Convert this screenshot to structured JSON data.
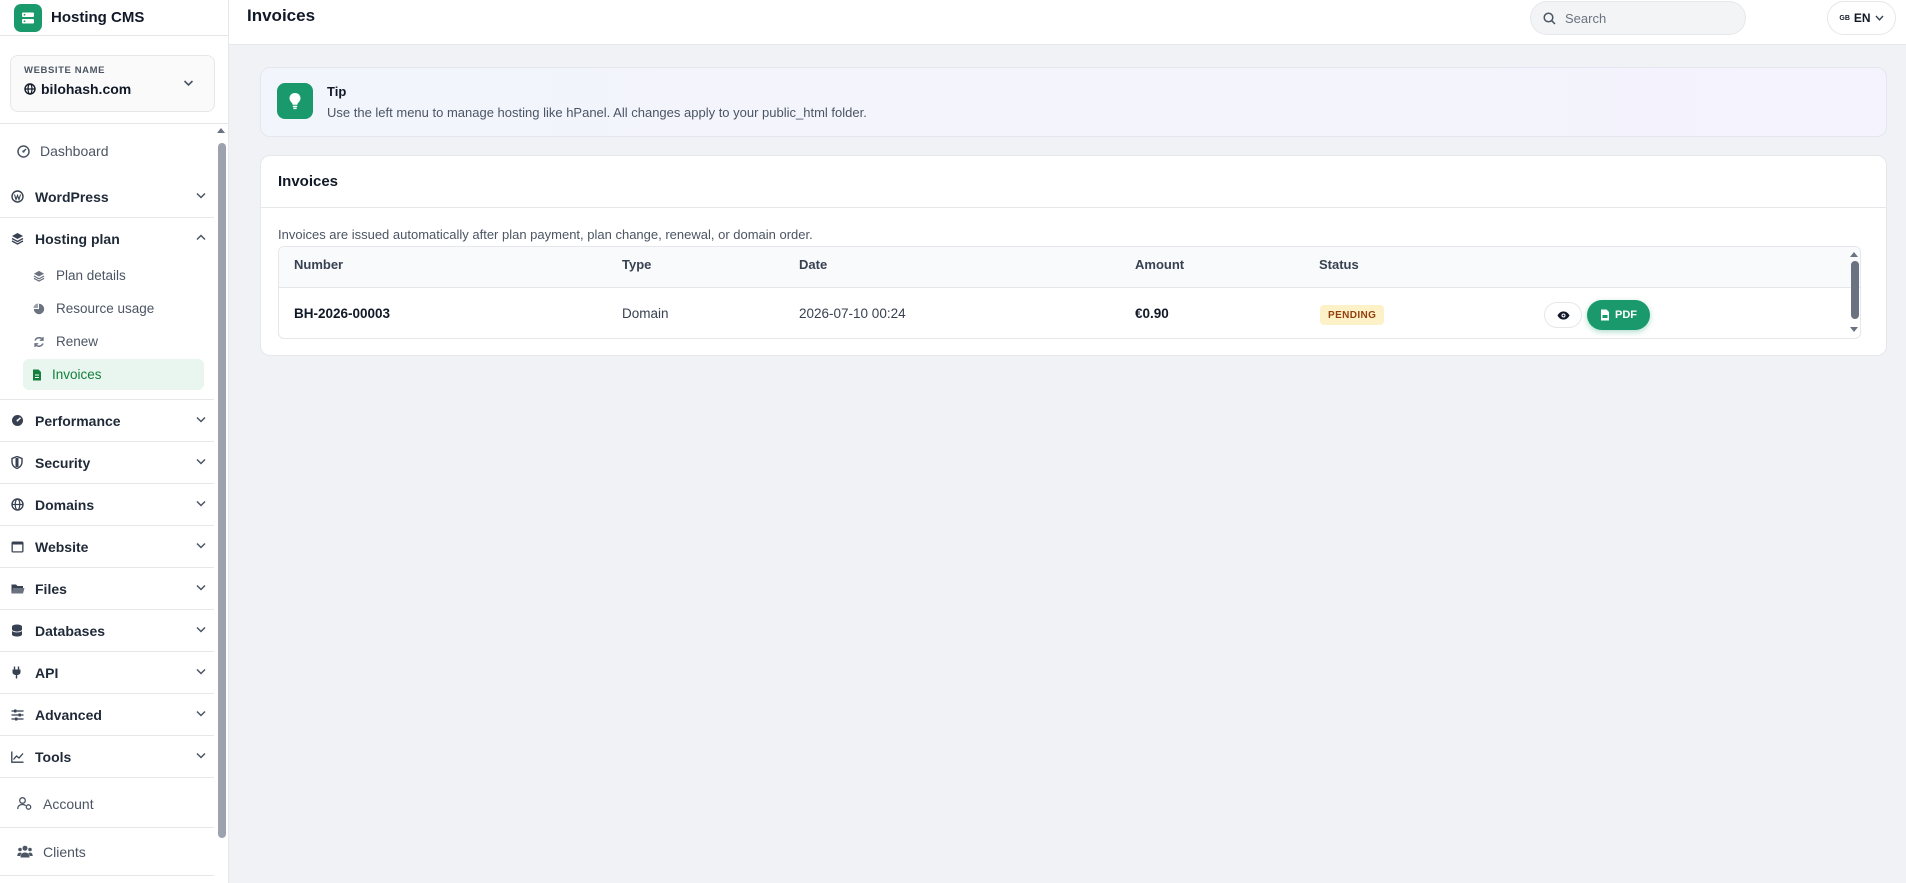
{
  "app": {
    "brand": "Hosting CMS",
    "accent_color": "#1a9a6c"
  },
  "header": {
    "title": "Invoices",
    "search_placeholder": "Search",
    "language": "EN",
    "language_flag": "GB"
  },
  "website": {
    "label": "WEBSITE NAME",
    "name": "bilohash.com"
  },
  "sidebar": {
    "items": [
      {
        "label": "Dashboard",
        "icon": "dashboard-icon"
      },
      {
        "label": "WordPress",
        "icon": "wordpress-icon"
      },
      {
        "label": "Hosting plan",
        "icon": "layers-icon",
        "expanded": true,
        "children": [
          {
            "label": "Plan details",
            "icon": "layers-icon"
          },
          {
            "label": "Resource usage",
            "icon": "pie-chart-icon"
          },
          {
            "label": "Renew",
            "icon": "refresh-icon"
          },
          {
            "label": "Invoices",
            "icon": "invoice-icon",
            "active": true
          }
        ]
      },
      {
        "label": "Performance",
        "icon": "gauge-icon"
      },
      {
        "label": "Security",
        "icon": "shield-icon"
      },
      {
        "label": "Domains",
        "icon": "globe-icon"
      },
      {
        "label": "Website",
        "icon": "browser-icon"
      },
      {
        "label": "Files",
        "icon": "folder-icon"
      },
      {
        "label": "Databases",
        "icon": "database-icon"
      },
      {
        "label": "API",
        "icon": "plug-icon"
      },
      {
        "label": "Advanced",
        "icon": "sliders-icon"
      },
      {
        "label": "Tools",
        "icon": "chart-icon"
      },
      {
        "label": "Account",
        "icon": "user-gear-icon"
      },
      {
        "label": "Clients",
        "icon": "users-icon"
      }
    ]
  },
  "tip": {
    "title": "Tip",
    "text": "Use the left menu to manage hosting like hPanel. All changes apply to your public_html folder."
  },
  "invoices": {
    "title": "Invoices",
    "description": "Invoices are issued automatically after plan payment, plan change, renewal, or domain order.",
    "columns": [
      "Number",
      "Type",
      "Date",
      "Amount",
      "Status"
    ],
    "rows": [
      {
        "number": "BH-2026-00003",
        "type": "Domain",
        "date": "2026-07-10 00:24",
        "amount": "€0.90",
        "status": "PENDING",
        "pdf_label": "PDF"
      }
    ],
    "status_color": "#fdf1c7"
  }
}
